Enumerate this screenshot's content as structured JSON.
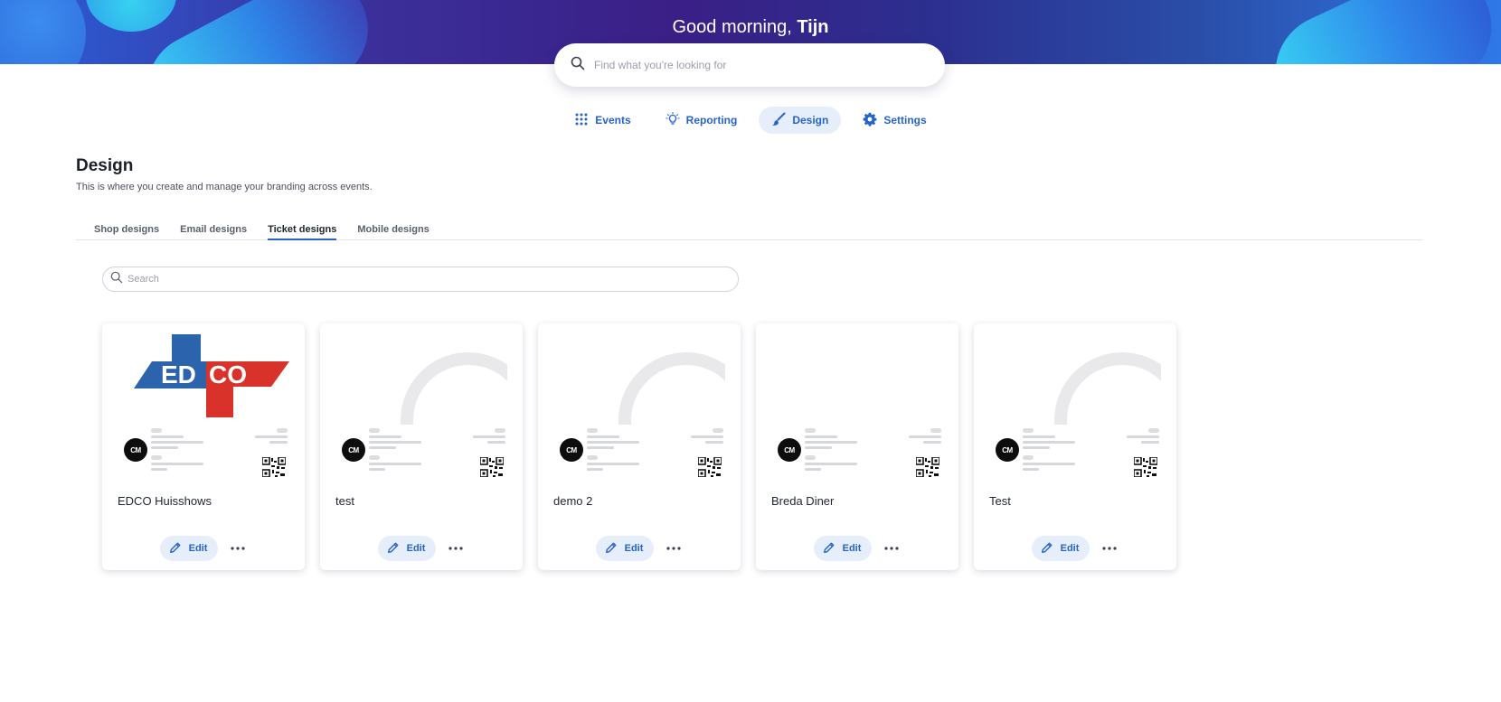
{
  "header": {
    "greeting_prefix": "Good morning,",
    "user_name": "Tijn",
    "search_placeholder": "Find what you're looking for"
  },
  "nav": {
    "items": [
      {
        "label": "Events",
        "icon": "grid-icon",
        "active": false
      },
      {
        "label": "Reporting",
        "icon": "lightbulb-icon",
        "active": false
      },
      {
        "label": "Design",
        "icon": "paintbrush-icon",
        "active": true
      },
      {
        "label": "Settings",
        "icon": "gear-icon",
        "active": false
      }
    ]
  },
  "page": {
    "title": "Design",
    "subtitle": "This is where you create and manage your branding across events."
  },
  "tabs": [
    {
      "label": "Shop designs",
      "active": false
    },
    {
      "label": "Email designs",
      "active": false
    },
    {
      "label": "Ticket designs",
      "active": true
    },
    {
      "label": "Mobile designs",
      "active": false
    }
  ],
  "list_search": {
    "placeholder": "Search"
  },
  "cards": [
    {
      "name": "EDCO Huisshows",
      "image": "edco-logo",
      "logo_text": "EDCO",
      "edit_label": "Edit"
    },
    {
      "name": "test",
      "image": "cm-watermark",
      "edit_label": "Edit"
    },
    {
      "name": "demo 2",
      "image": "cm-watermark",
      "edit_label": "Edit"
    },
    {
      "name": "Breda Diner",
      "image": "cm-watermark",
      "edit_label": "Edit"
    },
    {
      "name": "Test",
      "image": "cm-watermark",
      "edit_label": "Edit"
    }
  ],
  "ticket_preview": {
    "brand_mark": "CM"
  },
  "colors": {
    "accent": "#2563c9",
    "accent_bg": "#e7eefb",
    "edco_blue": "#2b63ad",
    "edco_red": "#d8322a"
  }
}
